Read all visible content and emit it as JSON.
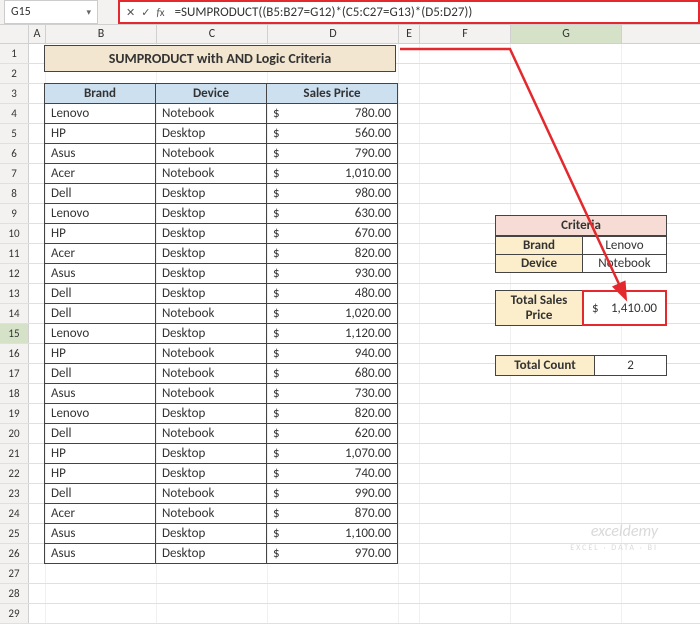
{
  "namebox": "G15",
  "formula": "=SUMPRODUCT((B5:B27=G12)*(C5:C27=G13)*(D5:D27))",
  "title": "SUMPRODUCT with AND Logic Criteria",
  "columns": [
    "A",
    "B",
    "C",
    "D",
    "E",
    "F",
    "G"
  ],
  "headers": {
    "brand": "Brand",
    "device": "Device",
    "price": "Sales Price"
  },
  "rows": [
    {
      "r": 5,
      "brand": "Lenovo",
      "device": "Notebook",
      "price": "780.00"
    },
    {
      "r": 6,
      "brand": "HP",
      "device": "Desktop",
      "price": "560.00"
    },
    {
      "r": 7,
      "brand": "Asus",
      "device": "Notebook",
      "price": "790.00"
    },
    {
      "r": 8,
      "brand": "Acer",
      "device": "Notebook",
      "price": "1,010.00"
    },
    {
      "r": 9,
      "brand": "Dell",
      "device": "Desktop",
      "price": "980.00"
    },
    {
      "r": 10,
      "brand": "Lenovo",
      "device": "Desktop",
      "price": "630.00"
    },
    {
      "r": 11,
      "brand": "HP",
      "device": "Desktop",
      "price": "670.00"
    },
    {
      "r": 12,
      "brand": "Acer",
      "device": "Desktop",
      "price": "820.00"
    },
    {
      "r": 13,
      "brand": "Asus",
      "device": "Desktop",
      "price": "930.00"
    },
    {
      "r": 14,
      "brand": "Dell",
      "device": "Desktop",
      "price": "480.00"
    },
    {
      "r": 15,
      "brand": "Dell",
      "device": "Notebook",
      "price": "1,020.00"
    },
    {
      "r": 16,
      "brand": "Lenovo",
      "device": "Desktop",
      "price": "1,120.00"
    },
    {
      "r": 17,
      "brand": "HP",
      "device": "Notebook",
      "price": "940.00"
    },
    {
      "r": 18,
      "brand": "Dell",
      "device": "Notebook",
      "price": "680.00"
    },
    {
      "r": 19,
      "brand": "Asus",
      "device": "Notebook",
      "price": "730.00"
    },
    {
      "r": 20,
      "brand": "Lenovo",
      "device": "Desktop",
      "price": "820.00"
    },
    {
      "r": 21,
      "brand": "Dell",
      "device": "Notebook",
      "price": "620.00"
    },
    {
      "r": 22,
      "brand": "HP",
      "device": "Desktop",
      "price": "1,070.00"
    },
    {
      "r": 23,
      "brand": "HP",
      "device": "Desktop",
      "price": "740.00"
    },
    {
      "r": 24,
      "brand": "Dell",
      "device": "Notebook",
      "price": "990.00"
    },
    {
      "r": 25,
      "brand": "Acer",
      "device": "Notebook",
      "price": "870.00"
    },
    {
      "r": 26,
      "brand": "Asus",
      "device": "Desktop",
      "price": "1,100.00"
    },
    {
      "r": 27,
      "brand": "Asus",
      "device": "Desktop",
      "price": "970.00"
    }
  ],
  "criteria": {
    "title": "Criteria",
    "brand_label": "Brand",
    "brand_value": "Lenovo",
    "device_label": "Device",
    "device_value": "Notebook"
  },
  "total_sales": {
    "label": "Total Sales Price",
    "symbol": "$",
    "value": "1,410.00"
  },
  "total_count": {
    "label": "Total Count",
    "value": "2"
  },
  "currency_symbol": "$",
  "watermark": {
    "main": "exceldemy",
    "sub": "EXCEL · DATA · BI"
  },
  "chart_data": {
    "type": "table",
    "title": "SUMPRODUCT with AND Logic Criteria",
    "columns": [
      "Brand",
      "Device",
      "Sales Price"
    ],
    "data": [
      [
        "Lenovo",
        "Notebook",
        780.0
      ],
      [
        "HP",
        "Desktop",
        560.0
      ],
      [
        "Asus",
        "Notebook",
        790.0
      ],
      [
        "Acer",
        "Notebook",
        1010.0
      ],
      [
        "Dell",
        "Desktop",
        980.0
      ],
      [
        "Lenovo",
        "Desktop",
        630.0
      ],
      [
        "HP",
        "Desktop",
        670.0
      ],
      [
        "Acer",
        "Desktop",
        820.0
      ],
      [
        "Asus",
        "Desktop",
        930.0
      ],
      [
        "Dell",
        "Desktop",
        480.0
      ],
      [
        "Dell",
        "Notebook",
        1020.0
      ],
      [
        "Lenovo",
        "Desktop",
        1120.0
      ],
      [
        "HP",
        "Notebook",
        940.0
      ],
      [
        "Dell",
        "Notebook",
        680.0
      ],
      [
        "Asus",
        "Notebook",
        730.0
      ],
      [
        "Lenovo",
        "Desktop",
        820.0
      ],
      [
        "Dell",
        "Notebook",
        620.0
      ],
      [
        "HP",
        "Desktop",
        1070.0
      ],
      [
        "HP",
        "Desktop",
        740.0
      ],
      [
        "Dell",
        "Notebook",
        990.0
      ],
      [
        "Acer",
        "Notebook",
        870.0
      ],
      [
        "Asus",
        "Desktop",
        1100.0
      ],
      [
        "Asus",
        "Desktop",
        970.0
      ]
    ],
    "criteria": {
      "Brand": "Lenovo",
      "Device": "Notebook"
    },
    "result_total_sales_price": 1410.0,
    "result_total_count": 2,
    "formula": "=SUMPRODUCT((B5:B27=G12)*(C5:C27=G13)*(D5:D27))"
  }
}
